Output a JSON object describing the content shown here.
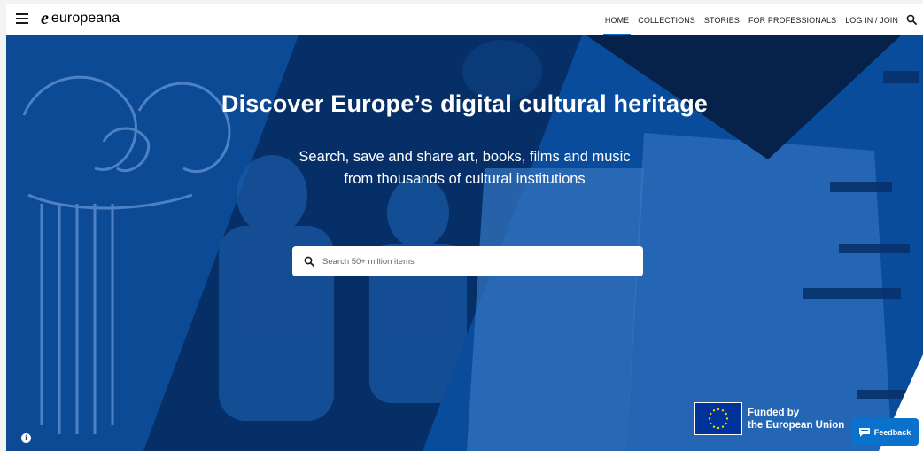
{
  "header": {
    "logo_mark": "e",
    "logo_text": "europeana",
    "nav": [
      {
        "label": "HOME",
        "active": true
      },
      {
        "label": "COLLECTIONS"
      },
      {
        "label": "STORIES"
      },
      {
        "label": "FOR PROFESSIONALS"
      },
      {
        "label": "LOG IN / JOIN"
      }
    ]
  },
  "hero": {
    "headline": "Discover Europe’s digital cultural heritage",
    "subline1": "Search, save and share art, books, films and music",
    "subline2": "from thousands of cultural institutions"
  },
  "search": {
    "placeholder": "Search 50+ million items"
  },
  "eu_banner": {
    "line1": "Funded by",
    "line2": "the European Union"
  },
  "feedback": {
    "label": "Feedback"
  },
  "info": {
    "label": "i"
  },
  "colors": {
    "accent": "#0a72cc",
    "hero_blue": "#05357a",
    "eu_blue": "#003399"
  },
  "icons": [
    "menu-icon",
    "search-icon",
    "feedback-icon",
    "info-icon"
  ]
}
